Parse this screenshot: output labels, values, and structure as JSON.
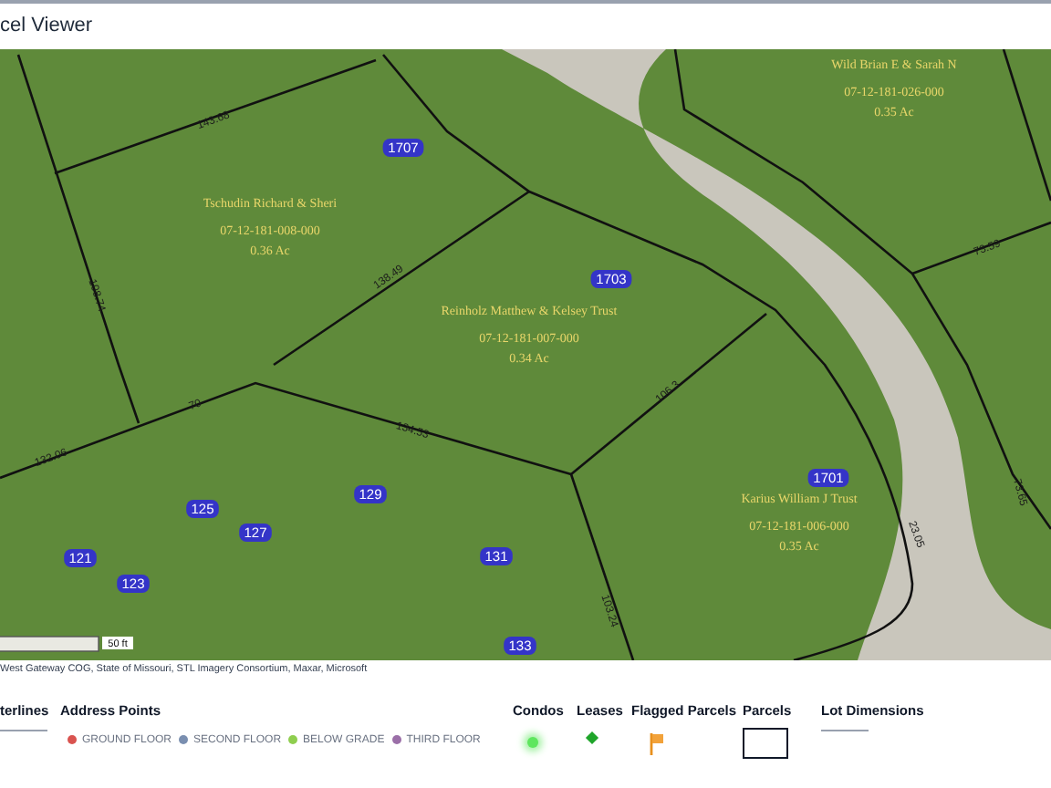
{
  "window": {
    "title": "cel Viewer"
  },
  "map": {
    "parcels": [
      {
        "owner": "Tschudin Richard & Sheri",
        "parcel_id": "07-12-181-008-000",
        "acreage": "0.36 Ac"
      },
      {
        "owner": "Wild Brian E & Sarah N",
        "parcel_id": "07-12-181-026-000",
        "acreage": "0.35 Ac"
      },
      {
        "owner": "Reinholz Matthew & Kelsey Trust",
        "parcel_id": "07-12-181-007-000",
        "acreage": "0.34 Ac"
      },
      {
        "owner": "Karius William J Trust",
        "parcel_id": "07-12-181-006-000",
        "acreage": "0.35 Ac"
      }
    ],
    "address_points": [
      "1707",
      "1703",
      "1701",
      "129",
      "125",
      "127",
      "121",
      "123",
      "131",
      "133"
    ],
    "lot_dimensions": [
      "143.68",
      "108.74",
      "138.49",
      "106.3",
      "134.53",
      "70",
      "132.06",
      "103.24",
      "73.59",
      "73.65",
      "23.05"
    ],
    "scale_bar": "50 ft",
    "attribution": "West Gateway COG, State of Missouri, STL Imagery Consortium, Maxar, Microsoft"
  },
  "legend": [
    {
      "kind": "line",
      "title": "terlines"
    },
    {
      "kind": "points",
      "title": "Address Points",
      "items": [
        {
          "label": "GROUND FLOOR",
          "color": "#d9534f"
        },
        {
          "label": "SECOND FLOOR",
          "color": "#7a8fb0"
        },
        {
          "label": "BELOW GRADE",
          "color": "#8fce4f"
        },
        {
          "label": "THIRD FLOOR",
          "color": "#9b6fa8"
        }
      ]
    },
    {
      "kind": "glow",
      "title": "Condos"
    },
    {
      "kind": "diamond",
      "title": "Leases"
    },
    {
      "kind": "flag",
      "title": "Flagged Parcels"
    },
    {
      "kind": "box",
      "title": "Parcels"
    },
    {
      "kind": "line",
      "title": "Lot Dimensions"
    }
  ]
}
